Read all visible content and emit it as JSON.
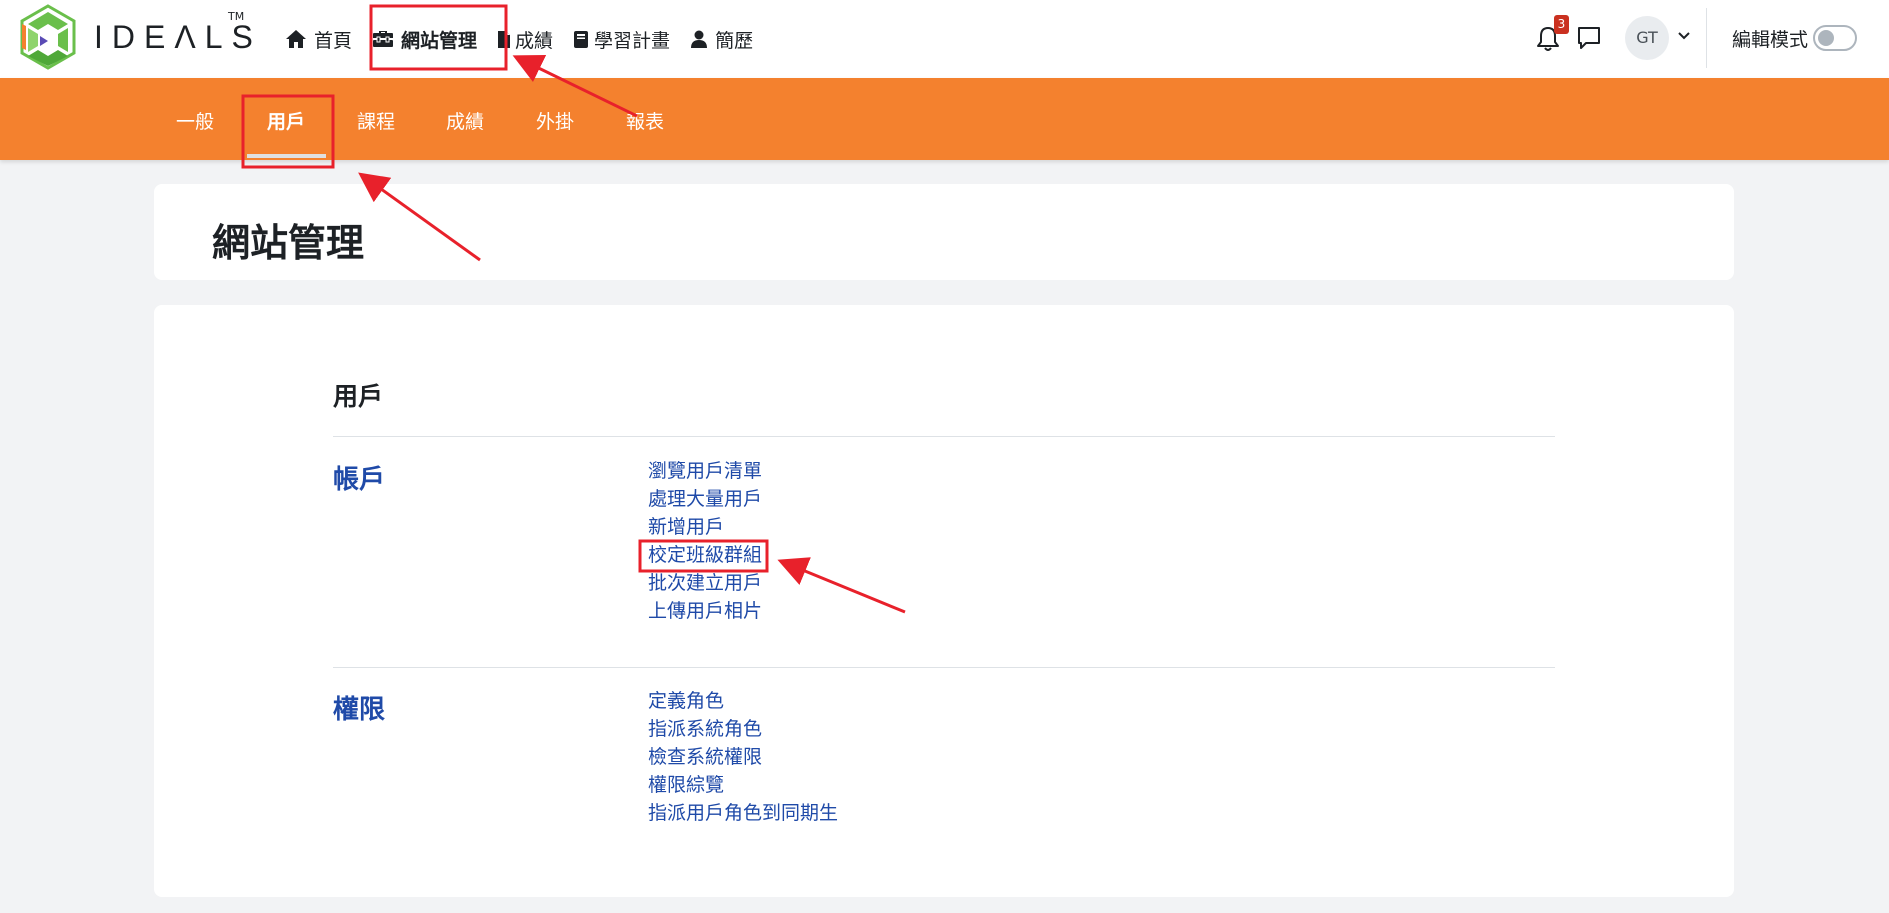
{
  "brand": {
    "name": "IDEΛLS",
    "tm": "TM"
  },
  "primary_nav": [
    {
      "label": "首頁",
      "icon": "home-icon"
    },
    {
      "label": "網站管理",
      "icon": "toolbox-icon",
      "active": true
    },
    {
      "label": "成績",
      "icon": "file-icon"
    },
    {
      "label": "學習計畫",
      "icon": "book-icon"
    },
    {
      "label": "簡歷",
      "icon": "user-icon"
    }
  ],
  "tools": {
    "notification_count": "3",
    "avatar_initials": "GT",
    "edit_mode_label": "編輯模式",
    "edit_mode_on": false
  },
  "secondary_nav": [
    {
      "label": "一般"
    },
    {
      "label": "用戶",
      "active": true
    },
    {
      "label": "課程"
    },
    {
      "label": "成績"
    },
    {
      "label": "外掛"
    },
    {
      "label": "報表"
    }
  ],
  "page": {
    "title": "網站管理"
  },
  "content": {
    "section_title": "用戶",
    "categories": [
      {
        "title": "帳戶",
        "links": [
          "瀏覽用戶清單",
          "處理大量用戶",
          "新增用戶",
          "校定班級群組",
          "批次建立用戶",
          "上傳用戶相片"
        ]
      },
      {
        "title": "權限",
        "links": [
          "定義角色",
          "指派系統角色",
          "檢查系統權限",
          "權限綜覽",
          "指派用戶角色到同期生"
        ]
      }
    ]
  },
  "colors": {
    "brand_orange": "#f4812e",
    "link_blue": "#1f4aa8",
    "annotation_red": "#e8212b",
    "logo_green": "#6abf4b"
  }
}
